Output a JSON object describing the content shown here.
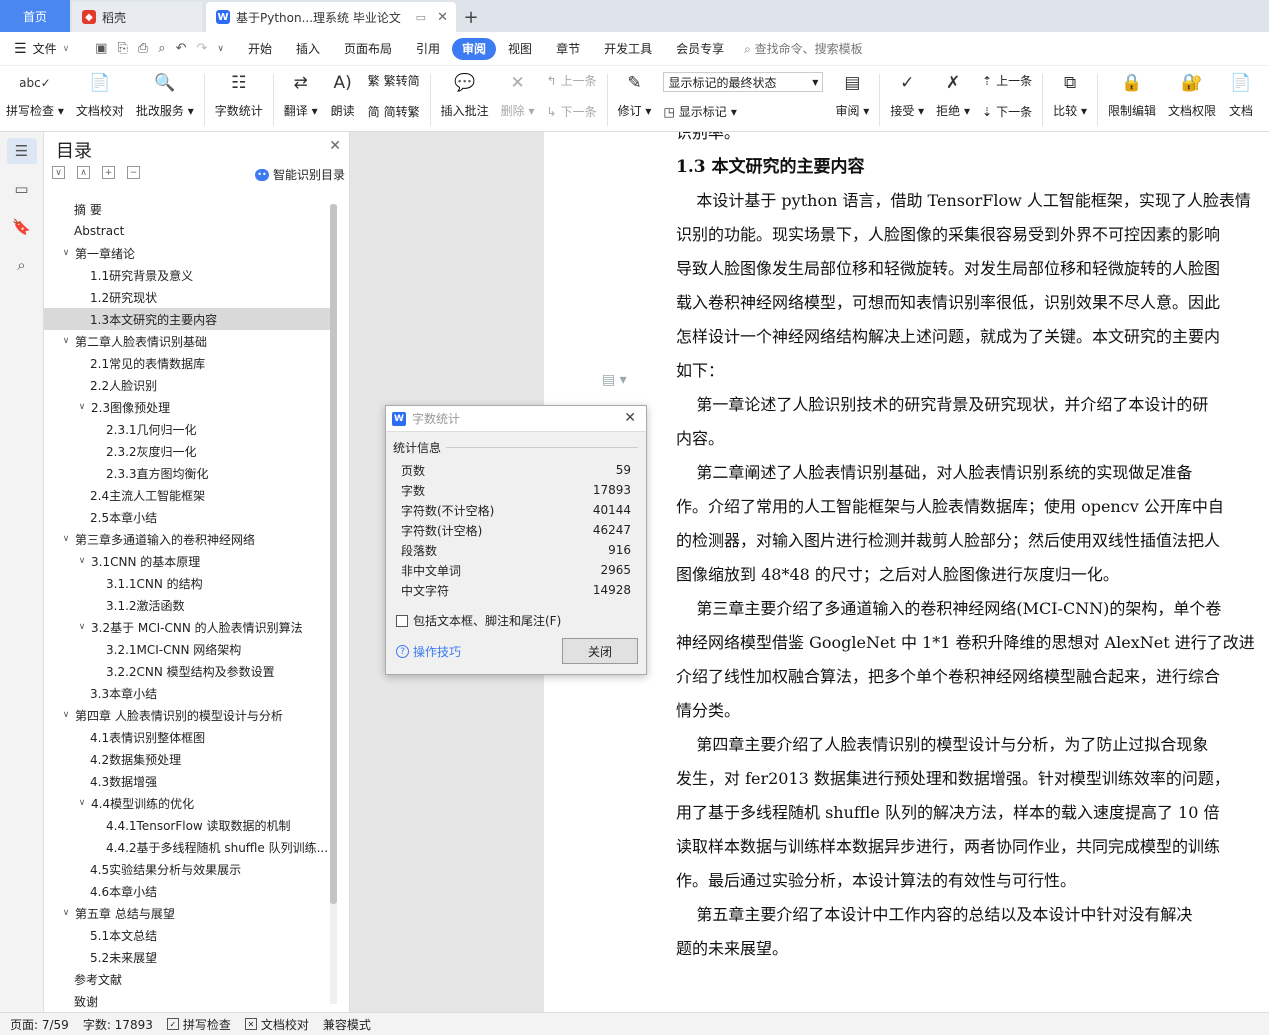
{
  "tabs": {
    "home": "首页",
    "docer": "稻壳",
    "document": "基于Python...理系统 毕业论文"
  },
  "menu": {
    "file": "文件",
    "items": [
      "开始",
      "插入",
      "页面布局",
      "引用",
      "审阅",
      "视图",
      "章节",
      "开发工具",
      "会员专享"
    ],
    "active": "审阅",
    "search": "查找命令、搜索模板"
  },
  "ribbon": {
    "spell_check": "拼写检查",
    "doc_proof": "文档校对",
    "batch_service": "批改服务",
    "word_count": "字数统计",
    "translate": "翻译",
    "read_aloud": "朗读",
    "to_traditional": "繁转简",
    "to_simplified": "简转繁",
    "insert_comment": "插入批注",
    "delete": "删除",
    "prev_comment": "上一条",
    "next_comment": "下一条",
    "track_changes": "修订",
    "mark_state": "显示标记的最终状态",
    "show_marks": "显示标记",
    "review": "审阅",
    "accept": "接受",
    "reject": "拒绝",
    "prev_change": "上一条",
    "next_change": "下一条",
    "compare": "比较",
    "restrict_edit": "限制编辑",
    "doc_permission": "文档权限",
    "doc_more": "文档"
  },
  "toc": {
    "title": "目录",
    "smart": "智能识别目录",
    "items": [
      {
        "label": "摘  要",
        "level": 0,
        "caret": ""
      },
      {
        "label": "Abstract",
        "level": 0,
        "caret": ""
      },
      {
        "label": "第一章绪论",
        "level": 0,
        "caret": "v"
      },
      {
        "label": "1.1研究背景及意义",
        "level": 1,
        "caret": ""
      },
      {
        "label": "1.2研究现状",
        "level": 1,
        "caret": ""
      },
      {
        "label": "1.3本文研究的主要内容",
        "level": 1,
        "caret": "",
        "selected": true
      },
      {
        "label": "第二章人脸表情识别基础",
        "level": 0,
        "caret": "v"
      },
      {
        "label": "2.1常见的表情数据库",
        "level": 1,
        "caret": ""
      },
      {
        "label": "2.2人脸识别",
        "level": 1,
        "caret": ""
      },
      {
        "label": "2.3图像预处理",
        "level": 1,
        "caret": "v"
      },
      {
        "label": "2.3.1几何归一化",
        "level": 2,
        "caret": ""
      },
      {
        "label": "2.3.2灰度归一化",
        "level": 2,
        "caret": ""
      },
      {
        "label": "2.3.3直方图均衡化",
        "level": 2,
        "caret": ""
      },
      {
        "label": "2.4主流人工智能框架",
        "level": 1,
        "caret": ""
      },
      {
        "label": "2.5本章小结",
        "level": 1,
        "caret": ""
      },
      {
        "label": "第三章多通道输入的卷积神经网络",
        "level": 0,
        "caret": "v"
      },
      {
        "label": "3.1CNN 的基本原理",
        "level": 1,
        "caret": "v"
      },
      {
        "label": "3.1.1CNN 的结构",
        "level": 2,
        "caret": ""
      },
      {
        "label": "3.1.2激活函数",
        "level": 2,
        "caret": ""
      },
      {
        "label": "3.2基于 MCI-CNN 的人脸表情识别算法",
        "level": 1,
        "caret": "v"
      },
      {
        "label": "3.2.1MCI-CNN 网络架构",
        "level": 2,
        "caret": ""
      },
      {
        "label": "3.2.2CNN 模型结构及参数设置",
        "level": 2,
        "caret": ""
      },
      {
        "label": "3.3本章小结",
        "level": 1,
        "caret": ""
      },
      {
        "label": "第四章  人脸表情识别的模型设计与分析",
        "level": 0,
        "caret": "v"
      },
      {
        "label": "4.1表情识别整体框图",
        "level": 1,
        "caret": ""
      },
      {
        "label": "4.2数据集预处理",
        "level": 1,
        "caret": ""
      },
      {
        "label": "4.3数据增强",
        "level": 1,
        "caret": ""
      },
      {
        "label": "4.4模型训练的优化",
        "level": 1,
        "caret": "v"
      },
      {
        "label": "4.4.1TensorFlow 读取数据的机制",
        "level": 2,
        "caret": ""
      },
      {
        "label": "4.4.2基于多线程随机 shuffle 队列训练...",
        "level": 2,
        "caret": ""
      },
      {
        "label": "4.5实验结果分析与效果展示",
        "level": 1,
        "caret": ""
      },
      {
        "label": "4.6本章小结",
        "level": 1,
        "caret": ""
      },
      {
        "label": "第五章  总结与展望",
        "level": 0,
        "caret": "v"
      },
      {
        "label": "5.1本文总结",
        "level": 1,
        "caret": ""
      },
      {
        "label": "5.2未来展望",
        "level": 1,
        "caret": ""
      },
      {
        "label": "参考文献",
        "level": 0,
        "caret": ""
      },
      {
        "label": "致谢",
        "level": 0,
        "caret": ""
      }
    ]
  },
  "document": {
    "lines": [
      {
        "text": "识别率。",
        "heading": false
      },
      {
        "text": "1.3 本文研究的主要内容",
        "heading": true
      },
      {
        "text": "    本设计基于 python 语言，借助 TensorFlow 人工智能框架，实现了人脸表情",
        "heading": false
      },
      {
        "text": "识别的功能。现实场景下，人脸图像的采集很容易受到外界不可控因素的影响",
        "heading": false
      },
      {
        "text": "导致人脸图像发生局部位移和轻微旋转。对发生局部位移和轻微旋转的人脸图",
        "heading": false
      },
      {
        "text": "载入卷积神经网络模型，可想而知表情识别率很低，识别效果不尽人意。因此",
        "heading": false
      },
      {
        "text": "怎样设计一个神经网络结构解决上述问题，就成为了关键。本文研究的主要内",
        "heading": false
      },
      {
        "text": "如下：",
        "heading": false
      },
      {
        "text": "    第一章论述了人脸识别技术的研究背景及研究现状，并介绍了本设计的研",
        "heading": false
      },
      {
        "text": "内容。",
        "heading": false
      },
      {
        "text": "    第二章阐述了人脸表情识别基础，对人脸表情识别系统的实现做足准备",
        "heading": false
      },
      {
        "text": "作。介绍了常用的人工智能框架与人脸表情数据库；使用 opencv 公开库中自",
        "heading": false
      },
      {
        "text": "的检测器，对输入图片进行检测并裁剪人脸部分；然后使用双线性插值法把人",
        "heading": false
      },
      {
        "text": "图像缩放到 48*48 的尺寸；之后对人脸图像进行灰度归一化。",
        "heading": false
      },
      {
        "text": "    第三章主要介绍了多通道输入的卷积神经网络(MCI-CNN)的架构，单个卷",
        "heading": false
      },
      {
        "text": "神经网络模型借鉴 GoogleNet 中 1*1 卷积升降维的思想对 AlexNet 进行了改进",
        "heading": false
      },
      {
        "text": "介绍了线性加权融合算法，把多个单个卷积神经网络模型融合起来，进行综合",
        "heading": false
      },
      {
        "text": "情分类。",
        "heading": false
      },
      {
        "text": "    第四章主要介绍了人脸表情识别的模型设计与分析，为了防止过拟合现象",
        "heading": false
      },
      {
        "text": "发生，对 fer2013 数据集进行预处理和数据增强。针对模型训练效率的问题，",
        "heading": false
      },
      {
        "text": "用了基于多线程随机 shuffle 队列的解决方法，样本的载入速度提高了 10 倍",
        "heading": false
      },
      {
        "text": "读取样本数据与训练样本数据异步进行，两者协同作业，共同完成模型的训练",
        "heading": false
      },
      {
        "text": "作。最后通过实验分析，本设计算法的有效性与可行性。",
        "heading": false
      },
      {
        "text": "    第五章主要介绍了本设计中工作内容的总结以及本设计中针对没有解决",
        "heading": false
      },
      {
        "text": "题的未来展望。",
        "heading": false
      }
    ]
  },
  "dialog": {
    "title": "字数统计",
    "section": "统计信息",
    "rows": [
      {
        "label": "页数",
        "value": "59"
      },
      {
        "label": "字数",
        "value": "17893"
      },
      {
        "label": "字符数(不计空格)",
        "value": "40144"
      },
      {
        "label": "字符数(计空格)",
        "value": "46247"
      },
      {
        "label": "段落数",
        "value": "916"
      },
      {
        "label": "非中文单词",
        "value": "2965"
      },
      {
        "label": "中文字符",
        "value": "14928"
      }
    ],
    "checkbox": "包括文本框、脚注和尾注(F)",
    "tips": "操作技巧",
    "close": "关闭"
  },
  "status": {
    "page": "页面: 7/59",
    "words": "字数: 17893",
    "spell": "拼写检查",
    "proof": "文档校对",
    "compat": "兼容模式"
  },
  "colors": {
    "accent": "#3d7bf2",
    "home_tab": "#4b87f0"
  }
}
